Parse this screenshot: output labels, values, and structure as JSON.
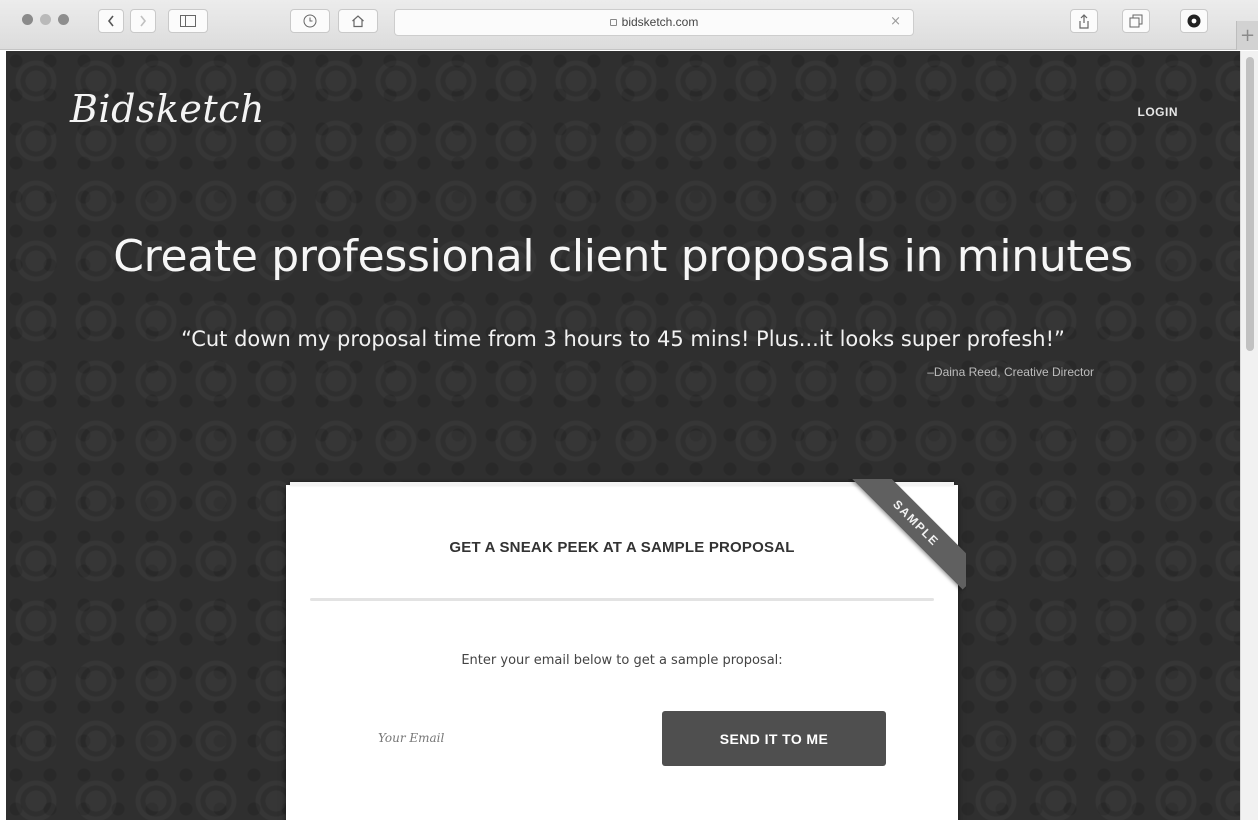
{
  "browser": {
    "url": "bidsketch.com",
    "clear_symbol": "×",
    "newtab_symbol": "+"
  },
  "header": {
    "logo": "Bidsketch",
    "login": "LOGIN"
  },
  "hero": {
    "headline": "Create professional client proposals in minutes",
    "quote": "“Cut down my proposal time from 3 hours to 45 mins! Plus...it looks super profesh!”",
    "attribution": "–Daina Reed, Creative Director"
  },
  "card": {
    "title": "GET A SNEAK PEEK AT A SAMPLE PROPOSAL",
    "instructions": "Enter your email below to get a sample proposal:",
    "email_placeholder": "Your Email",
    "email_value": "",
    "submit_label": "SEND IT TO ME",
    "ribbon": "SAMPLE"
  }
}
